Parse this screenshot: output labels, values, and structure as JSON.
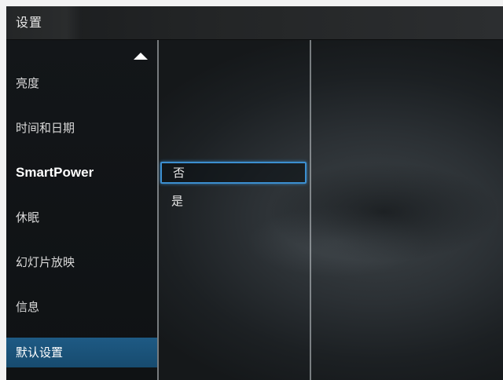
{
  "header": {
    "title": "设置"
  },
  "sidebar": {
    "scroll_up_icon": "triangle-up-icon",
    "items": [
      {
        "label": "亮度"
      },
      {
        "label": "时间和日期"
      },
      {
        "label": "SmartPower"
      },
      {
        "label": "休眠"
      },
      {
        "label": "幻灯片放映"
      },
      {
        "label": "信息"
      },
      {
        "label": "默认设置",
        "selected": true
      }
    ]
  },
  "options": {
    "items": [
      {
        "label": "否",
        "focused": true
      },
      {
        "label": "是"
      }
    ]
  },
  "colors": {
    "selection_blue": "#1e5a84",
    "focus_outline": "#3c8fd0"
  }
}
